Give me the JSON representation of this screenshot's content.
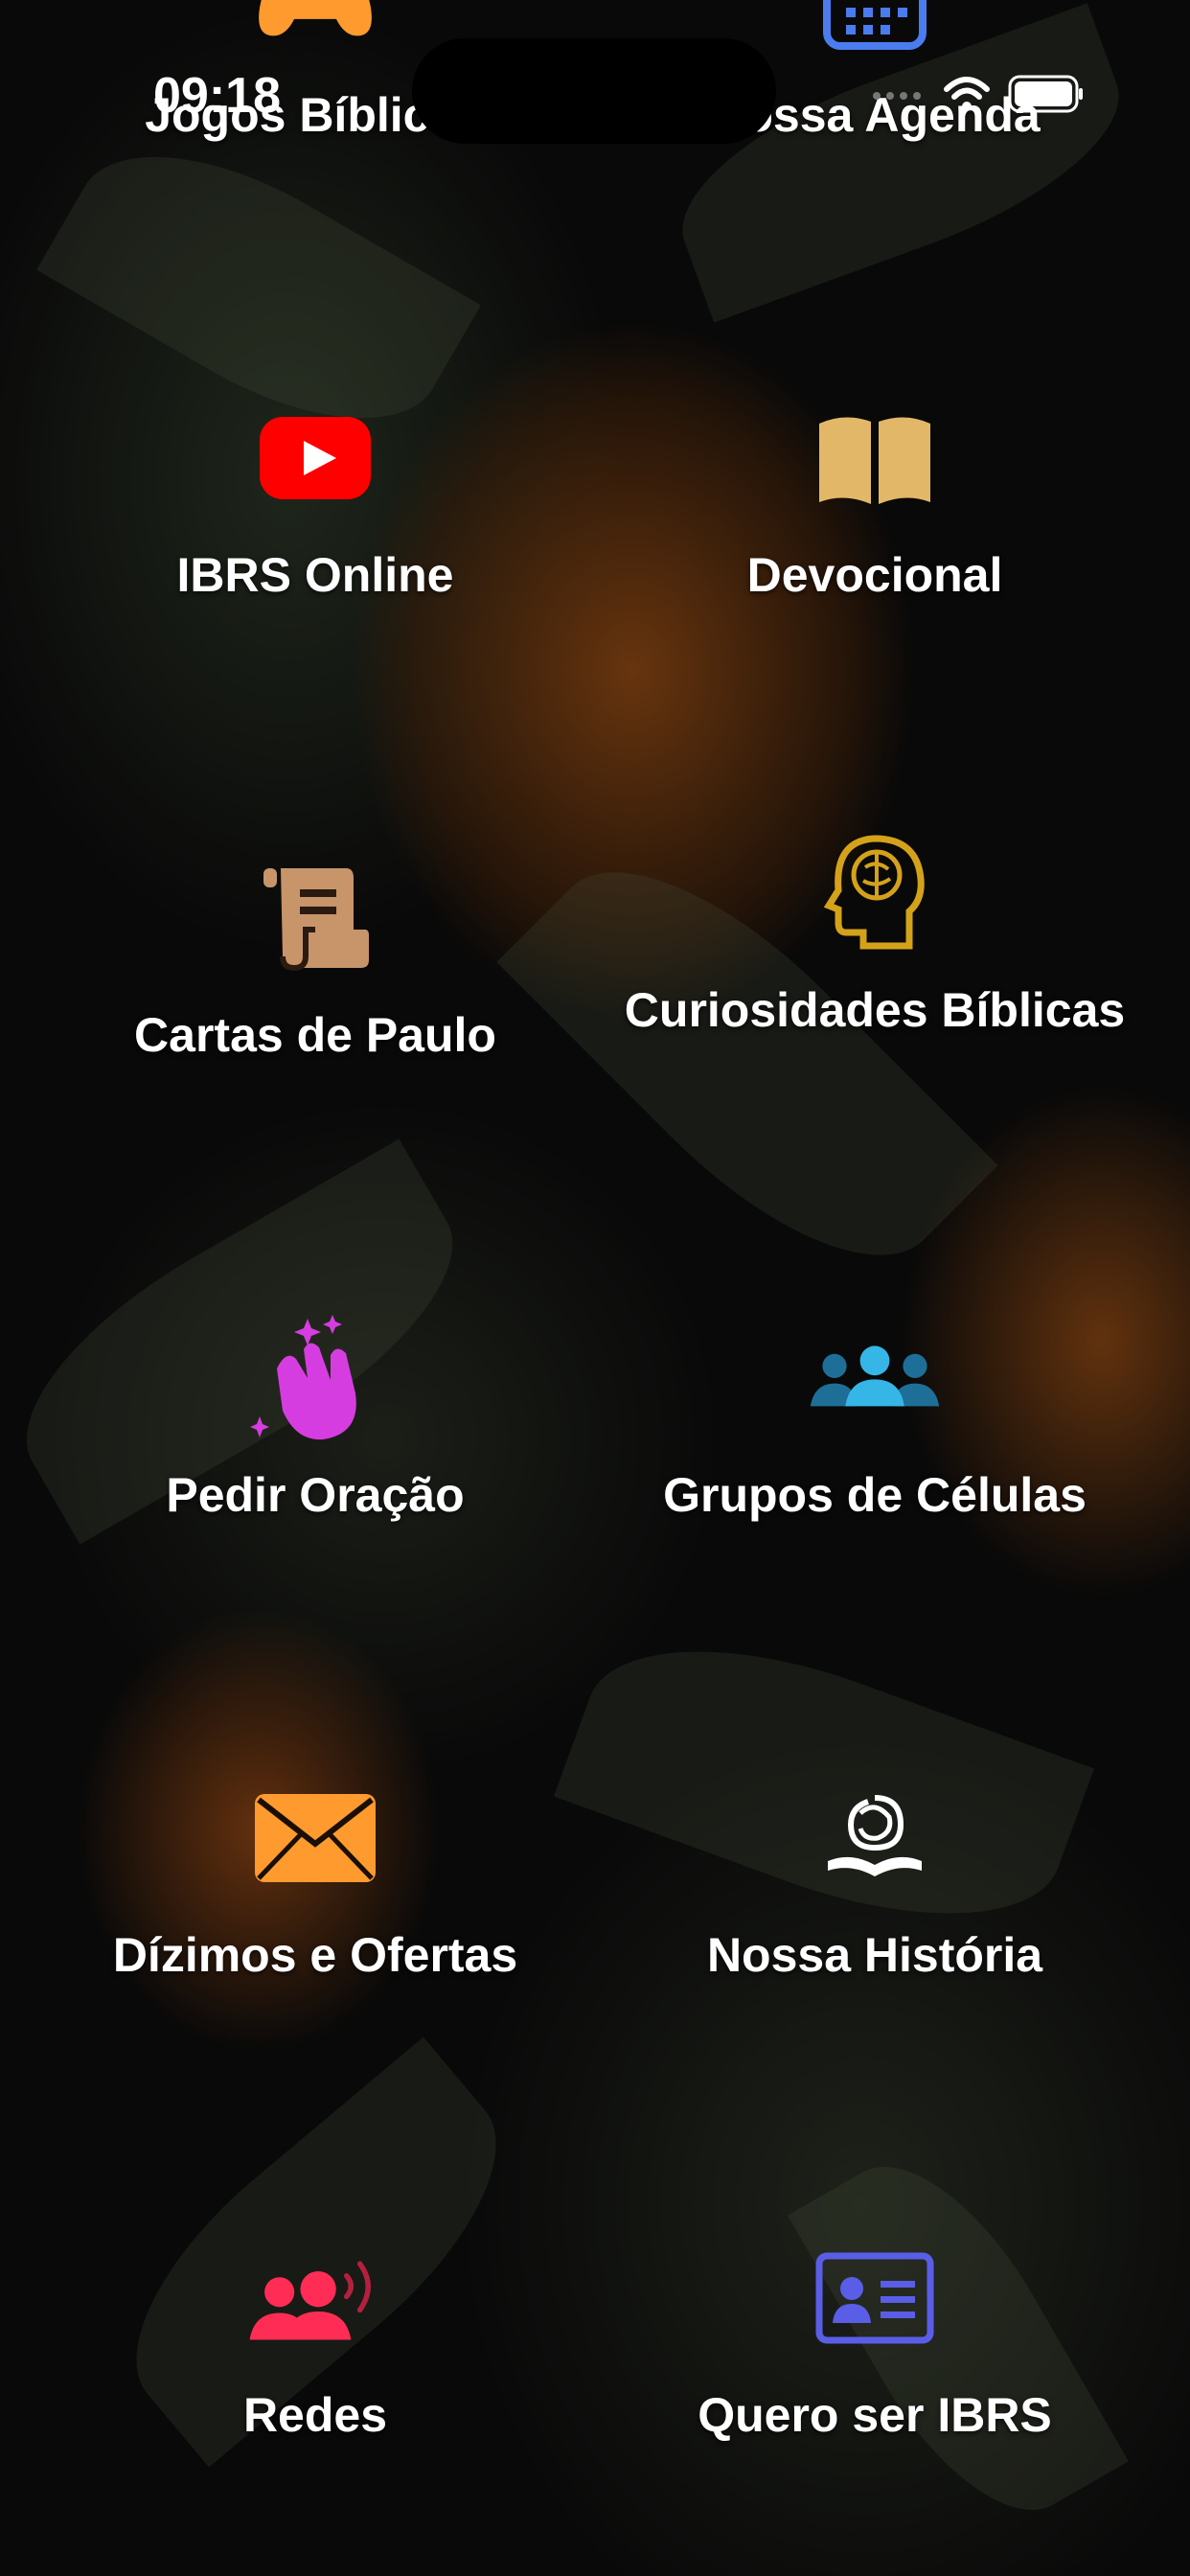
{
  "status_bar": {
    "time": "09:18"
  },
  "menu": [
    {
      "label": "Jogos Bíblicos",
      "icon": "gamepad-icon",
      "color": "#ff9a2f"
    },
    {
      "label": "Nossa Agenda",
      "icon": "calendar-icon",
      "color": "#4a7cf0"
    },
    {
      "label": "IBRS Online",
      "icon": "youtube-icon",
      "color": "#ff0000"
    },
    {
      "label": "Devocional",
      "icon": "book-icon",
      "color": "#e2b868"
    },
    {
      "label": "Cartas de Paulo",
      "icon": "scroll-icon",
      "color": "#c8946a"
    },
    {
      "label": "Curiosidades Bíblicas",
      "icon": "brain-icon",
      "color": "#d4a21a"
    },
    {
      "label": "Pedir Oração",
      "icon": "praying-hands-icon",
      "color": "#d63de0"
    },
    {
      "label": "Grupos de Células",
      "icon": "group-icon",
      "color": "#35b6e6"
    },
    {
      "label": "Dízimos e Ofertas",
      "icon": "envelope-icon",
      "color": "#ff9a2f"
    },
    {
      "label": "Nossa História",
      "icon": "history-logo-icon",
      "color": "#ffffff"
    },
    {
      "label": "Redes",
      "icon": "network-users-icon",
      "color": "#ff2d55"
    },
    {
      "label": "Quero ser IBRS",
      "icon": "id-card-icon",
      "color": "#5a5ee6"
    }
  ]
}
